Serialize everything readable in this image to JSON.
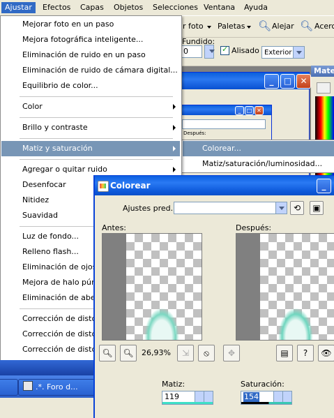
{
  "menubar": {
    "items": [
      {
        "label": "Ajustar",
        "active": true
      },
      {
        "label": "Efectos"
      },
      {
        "label": "Capas"
      },
      {
        "label": "Objetos"
      },
      {
        "label": "Selecciones"
      },
      {
        "label": "Ventana"
      },
      {
        "label": "Ayuda"
      }
    ]
  },
  "toolbar": {
    "foto_label": "r foto",
    "paletas_label": "Paletas",
    "alejar_label": "Alejar",
    "acercar_label": "Acerc",
    "fundido_label": "Fundido:",
    "fundido_value": "0",
    "alisado_label": "Alisado",
    "mode_value": "Exterior",
    "material_label": "Mate"
  },
  "inner_window": {
    "field_label": "Después:"
  },
  "menu": {
    "items": [
      {
        "label": "Mejorar foto en un paso"
      },
      {
        "label": "Mejora fotográfica inteligente..."
      },
      {
        "label": "Eliminación de ruido en un paso"
      },
      {
        "label": "Eliminación de ruido de cámara digital..."
      },
      {
        "label": "Equilibrio de color..."
      },
      {
        "label": "Color"
      },
      {
        "label": "Brillo y contraste"
      },
      {
        "label": "Matiz y saturación"
      },
      {
        "label": "Agregar o quitar ruido"
      },
      {
        "label": "Desenfocar"
      },
      {
        "label": "Nitidez"
      },
      {
        "label": "Suavidad"
      },
      {
        "label": "Luz de fondo..."
      },
      {
        "label": "Relleno flash..."
      },
      {
        "label": "Eliminación de ojos ro"
      },
      {
        "label": "Mejora de halo púrpu"
      },
      {
        "label": "Eliminación de aberrac"
      },
      {
        "label": "Corrección de distorsi"
      },
      {
        "label": "Corrección de distorsi"
      },
      {
        "label": "Corrección de distorsi"
      }
    ]
  },
  "submenu": {
    "items": [
      {
        "label": "Colorear..."
      },
      {
        "label": "Matiz/saturación/luminosidad..."
      }
    ]
  },
  "taskbar": {
    "button_label": ".*. Foro d..."
  },
  "dialog": {
    "title": "Colorear",
    "presets_label": "Ajustes pred.:",
    "presets_value": "",
    "before_label": "Antes:",
    "after_label": "Después:",
    "zoom": "26,93%",
    "matiz_label": "Matiz:",
    "matiz_value": "119",
    "saturacion_label": "Saturación:",
    "saturacion_value": "154"
  },
  "colors": {
    "menu_highlight": "#7896b6",
    "titlebar": "#0b5ee0",
    "hue_bar": "#3ee0c8"
  }
}
